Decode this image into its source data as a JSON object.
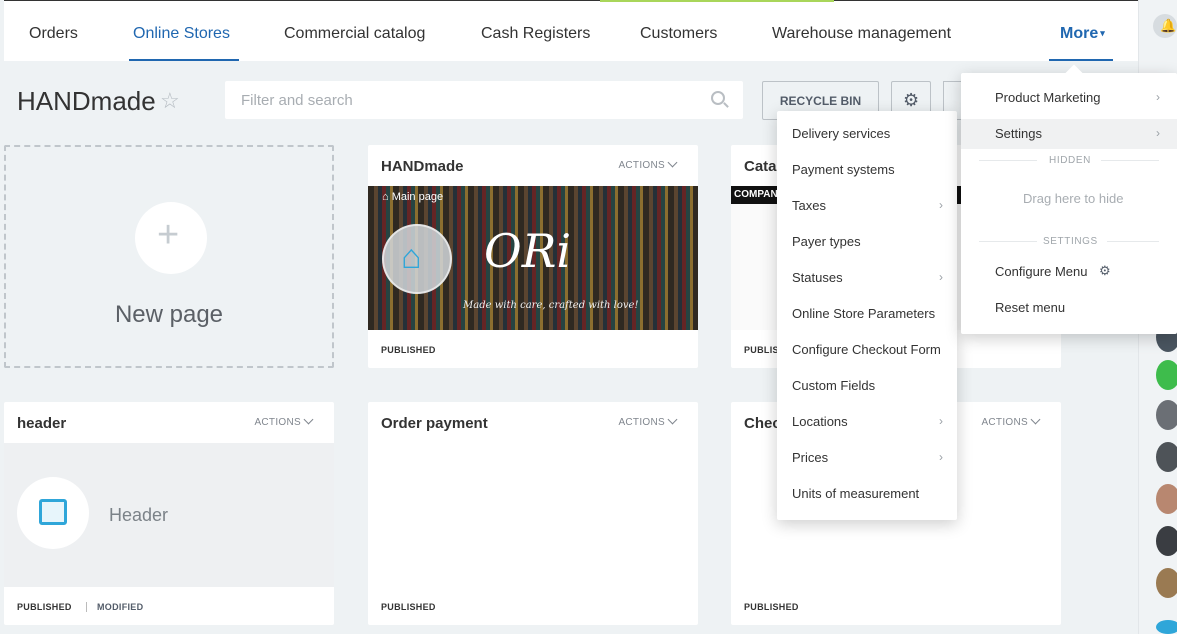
{
  "nav": {
    "items": [
      "Orders",
      "Online Stores",
      "Commercial catalog",
      "Cash Registers",
      "Customers",
      "Warehouse management"
    ],
    "more": "More"
  },
  "page": {
    "title": "HANDmade",
    "search_placeholder": "Filter and search",
    "recycle_bin": "RECYCLE BIN"
  },
  "new_page": {
    "label": "New page"
  },
  "cards": [
    {
      "title": "HANDmade",
      "actions": "ACTIONS",
      "status": "PUBLISHED",
      "preview_label": "Main page",
      "preview_logo": "ORi",
      "preview_tagline": "Made with care, crafted with love!"
    },
    {
      "title": "Catal",
      "status": "PUBLISH",
      "preview_banner": "COMPANY"
    },
    {
      "title": "header",
      "actions": "ACTIONS",
      "status": "PUBLISHED",
      "status2": "MODIFIED",
      "preview_label": "Header"
    },
    {
      "title": "Order payment",
      "actions": "ACTIONS",
      "status": "PUBLISHED"
    },
    {
      "title": "Chec",
      "actions": "ACTIONS",
      "status": "PUBLISHED"
    }
  ],
  "submenu": {
    "items": [
      {
        "label": "Delivery services",
        "arrow": false
      },
      {
        "label": "Payment systems",
        "arrow": false
      },
      {
        "label": "Taxes",
        "arrow": true
      },
      {
        "label": "Payer types",
        "arrow": false
      },
      {
        "label": "Statuses",
        "arrow": true
      },
      {
        "label": "Online Store Parameters",
        "arrow": false
      },
      {
        "label": "Configure Checkout Form",
        "arrow": false
      },
      {
        "label": "Custom Fields",
        "arrow": false
      },
      {
        "label": "Locations",
        "arrow": true
      },
      {
        "label": "Prices",
        "arrow": true
      },
      {
        "label": "Units of measurement",
        "arrow": false
      }
    ]
  },
  "more_menu": {
    "product_marketing": "Product Marketing",
    "settings": "Settings",
    "hidden_section": "HIDDEN",
    "drag_hint": "Drag here to hide",
    "settings_section": "SETTINGS",
    "configure_menu": "Configure Menu",
    "reset_menu": "Reset menu"
  },
  "colors": {
    "accent": "#2067b0",
    "icon_blue": "#2fa6d9",
    "background": "#eef2f4"
  }
}
